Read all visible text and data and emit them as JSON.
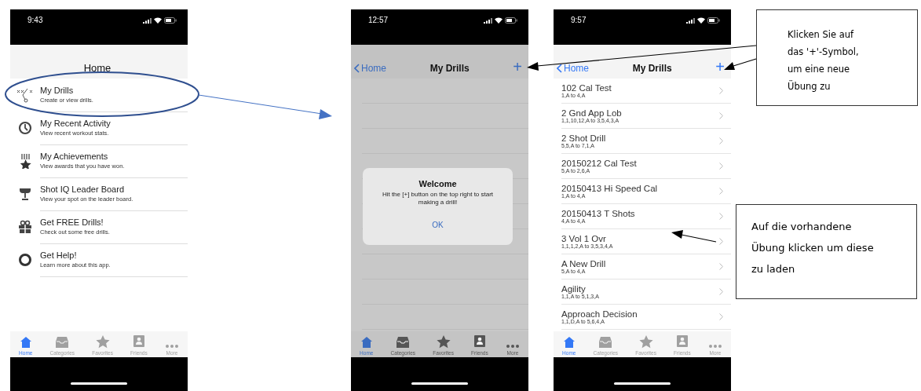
{
  "screens": [
    {
      "kind": "menu",
      "status_time": "9:43",
      "nav": {
        "title": "Home"
      },
      "menu_items": [
        {
          "title": "My Drills",
          "subtitle": "Create or view drills."
        },
        {
          "title": "My Recent Activity",
          "subtitle": "View recent workout stats."
        },
        {
          "title": "My Achievements",
          "subtitle": "View awards that you have won."
        },
        {
          "title": "Shot IQ Leader Board",
          "subtitle": "View your spot on the leader board."
        },
        {
          "title": "Get FREE Drills!",
          "subtitle": "Check out some free drills."
        },
        {
          "title": "Get Help!",
          "subtitle": "Learn more about this app."
        }
      ],
      "tab_bar": [
        {
          "label": "Home",
          "selected": true
        },
        {
          "label": "Categories",
          "selected": false
        },
        {
          "label": "Favorites",
          "selected": false
        },
        {
          "label": "Friends",
          "selected": false
        },
        {
          "label": "More",
          "selected": false
        }
      ]
    },
    {
      "kind": "alert",
      "status_time": "12:57",
      "nav": {
        "back": "Home",
        "title": "My Drills",
        "add": "+"
      },
      "alert": {
        "title": "Welcome",
        "message": "Hit the [+] button on the top right to start making a drill!",
        "button": "OK"
      },
      "tab_bar": [
        {
          "label": "Home",
          "selected": true
        },
        {
          "label": "Categories",
          "selected": false
        },
        {
          "label": "Favorites",
          "selected": false
        },
        {
          "label": "Friends",
          "selected": false
        },
        {
          "label": "More",
          "selected": false
        }
      ]
    },
    {
      "kind": "list",
      "status_time": "9:57",
      "nav": {
        "back": "Home",
        "title": "My Drills",
        "add": "+"
      },
      "drills": [
        {
          "name": "102 Cal Test",
          "detail": "1,A to 4,A"
        },
        {
          "name": "2 Gnd App Lob",
          "detail": "1,1,10,12,A to 3,5,4,3,A"
        },
        {
          "name": "2 Shot Drill",
          "detail": "5,5,A to 7,1,A"
        },
        {
          "name": "20150212 Cal Test",
          "detail": "5,A to 2,6,A"
        },
        {
          "name": "20150413 Hi Speed Cal",
          "detail": "1,A to 4,A"
        },
        {
          "name": "20150413 T Shots",
          "detail": "4,A to 4,A"
        },
        {
          "name": "3 Vol 1 Ovr",
          "detail": "1,1,1,2,A to 3,5,3,4,A"
        },
        {
          "name": "A New Drill",
          "detail": "5,A to 4,A"
        },
        {
          "name": "Agility",
          "detail": "1,1,A to 5,1,3,A"
        },
        {
          "name": "Approach Decision",
          "detail": "1,1,D,A to 5,6,4,A"
        }
      ],
      "tab_bar": [
        {
          "label": "Home",
          "selected": true
        },
        {
          "label": "Categories",
          "selected": false
        },
        {
          "label": "Favorites",
          "selected": false
        },
        {
          "label": "Friends",
          "selected": false
        },
        {
          "label": "More",
          "selected": false
        }
      ]
    }
  ],
  "callouts": [
    {
      "text": "Klicken Sie auf das '+'-Symbol, um eine neue Übung zu"
    },
    {
      "text": "Auf die vorhandene Übung klicken um diese zu laden"
    }
  ]
}
